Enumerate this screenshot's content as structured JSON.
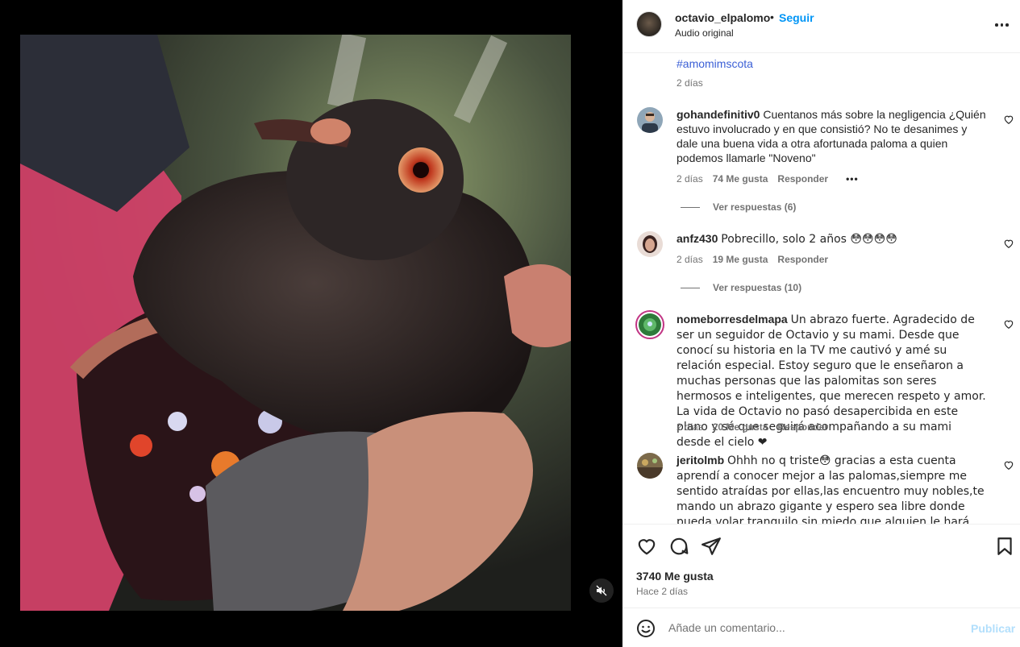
{
  "header": {
    "username": "octavio_elpalomo",
    "separator": "•",
    "follow_label": "Seguir",
    "audio_label": "Audio original"
  },
  "caption": {
    "hashtag": "#amomimscota",
    "time": "2 días"
  },
  "comments": [
    {
      "username": "gohandefinitiv0",
      "text": "Cuentanos más sobre la negligencia ¿Quién estuvo involucrado y en que consistió? No te desanimes y dale una buena vida a otra afortunada paloma a quien podemos llamarle \"Noveno\"",
      "time": "2 días",
      "likes": "74 Me gusta",
      "reply_label": "Responder",
      "more": "•••",
      "view_replies": "Ver respuestas (6)"
    },
    {
      "username": "anfz430",
      "text": "Pobrecillo, solo 2 años 😳😳😳😳",
      "time": "2 días",
      "likes": "19 Me gusta",
      "reply_label": "Responder",
      "view_replies": "Ver respuestas (10)"
    },
    {
      "username": "nomeborresdelmapa",
      "text": "Un abrazo fuerte. Agradecido de ser un seguidor de Octavio y su mami. Desde que conocí su historia en la TV me cautivó y amé su relación especial. Estoy seguro que le enseñaron a muchas personas que las palomitas son seres hermosos e inteligentes, que merecen respeto y amor. La vida de Octavio no pasó desapercibida en este plano y sé que seguirá acompañando a su mami desde el cielo ❤",
      "time": "2 días",
      "likes": "20 Me gusta",
      "reply_label": "Responder"
    },
    {
      "username": "jeritolmb",
      "text": "Ohhh no q triste😳 gracias a esta cuenta aprendí a conocer mejor a las palomas,siempre me sentido atraídas por ellas,las encuentro muy nobles,te mando un abrazo gigante y espero sea libre donde pueda volar tranquilo sin miedo que alguien le hará daño alguno ❤"
    }
  ],
  "post": {
    "likes": "3740 Me gusta",
    "posted_ago": "Hace 2 días"
  },
  "comment_box": {
    "placeholder": "Añade un comentario...",
    "post_label": "Publicar"
  },
  "colors": {
    "accent": "#0095f6",
    "hashtag": "#3b5fd6",
    "muted": "#737373",
    "heart": "#ff3040"
  }
}
